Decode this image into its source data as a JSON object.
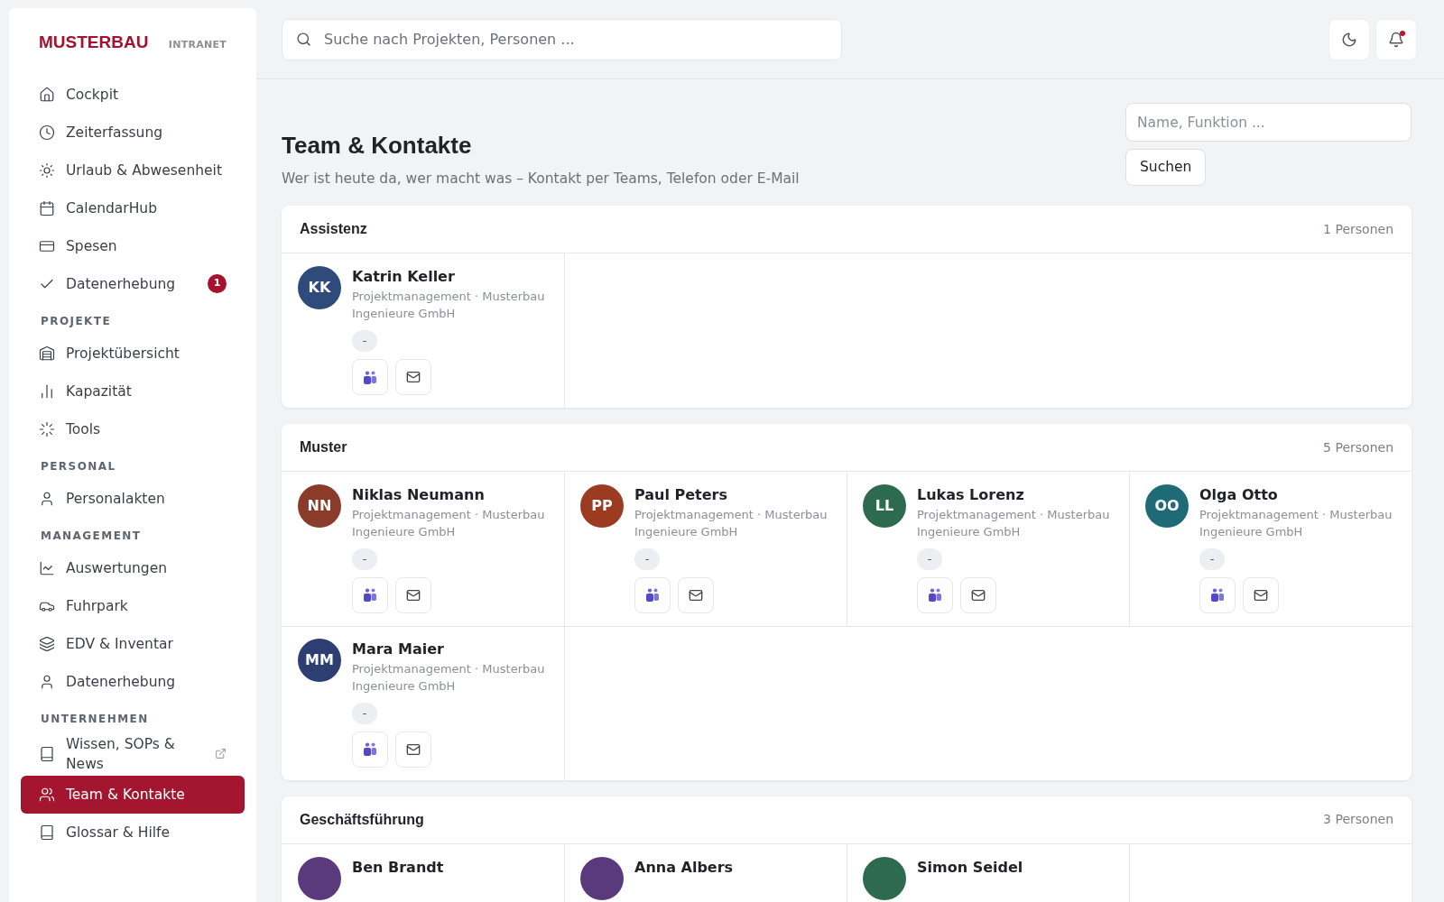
{
  "brand": {
    "name": "MUSTERBAU",
    "tag": "INTRANET"
  },
  "nav": [
    {
      "items": [
        {
          "label": "Cockpit",
          "selected": false
        },
        {
          "label": "Zeiterfassung",
          "selected": false
        },
        {
          "label": "Urlaub & Abwesenheit",
          "selected": false
        },
        {
          "label": "CalendarHub",
          "selected": false
        },
        {
          "label": "Spesen",
          "selected": false
        },
        {
          "label": "Datenerhebung",
          "selected": false,
          "badge": "1"
        }
      ]
    },
    {
      "heading": "PROJEKTE",
      "items": [
        {
          "label": "Projektübersicht",
          "selected": false
        },
        {
          "label": "Kapazität",
          "selected": false
        },
        {
          "label": "Tools",
          "selected": false
        }
      ]
    },
    {
      "heading": "PERSONAL",
      "items": [
        {
          "label": "Personalakten",
          "selected": false
        }
      ]
    },
    {
      "heading": "MANAGEMENT",
      "items": [
        {
          "label": "Auswertungen",
          "selected": false
        },
        {
          "label": "Fuhrpark",
          "selected": false
        },
        {
          "label": "EDV & Inventar",
          "selected": false
        },
        {
          "label": "Datenerhebung",
          "selected": false
        }
      ]
    },
    {
      "heading": "UNTERNEHMEN",
      "items": [
        {
          "label": "Wissen, SOPs & News",
          "selected": false,
          "external": true
        },
        {
          "label": "Team & Kontakte",
          "selected": true
        },
        {
          "label": "Glossar & Hilfe",
          "selected": false
        }
      ]
    }
  ],
  "topbar": {
    "search": {
      "placeholder": "Suche nach Projekten, Personen ..."
    },
    "notification_unread": true
  },
  "page": {
    "title": "Team & Kontakte",
    "subtitle": "Wer ist heute da, wer macht was – Kontakt per Teams, Telefon oder E-Mail",
    "filter": {
      "placeholder": "Name, Funktion ..."
    },
    "button": "Suchen"
  },
  "groups": [
    {
      "name": "Assistenz",
      "count": "1 Personen",
      "people": [
        {
          "initials": "KK",
          "color": "#2f4b7c",
          "name": "Katrin Keller",
          "role": "Projektmanagement · Musterbau Ingenieure GmbH",
          "status": "-"
        }
      ]
    },
    {
      "name": "Muster",
      "count": "5 Personen",
      "people": [
        {
          "initials": "NN",
          "color": "#8a3b2a",
          "name": "Niklas Neumann",
          "role": "Projektmanagement · Musterbau Ingenieure GmbH",
          "status": "-"
        },
        {
          "initials": "PP",
          "color": "#9b3b22",
          "name": "Paul Peters",
          "role": "Projektmanagement · Musterbau Ingenieure GmbH",
          "status": "-"
        },
        {
          "initials": "LL",
          "color": "#2e6b4e",
          "name": "Lukas Lorenz",
          "role": "Projektmanagement · Musterbau Ingenieure GmbH",
          "status": "-"
        },
        {
          "initials": "OO",
          "color": "#1e6a76",
          "name": "Olga Otto",
          "role": "Projektmanagement · Musterbau Ingenieure GmbH",
          "status": "-"
        },
        {
          "initials": "MM",
          "color": "#2c3e72",
          "name": "Mara Maier",
          "role": "Projektmanagement · Musterbau Ingenieure GmbH",
          "status": "-"
        }
      ]
    },
    {
      "name": "Geschäftsführung",
      "count": "3 Personen",
      "people": [
        {
          "color": "#5a3a7c",
          "name": "Ben Brandt"
        },
        {
          "color": "#5a3a7c",
          "name": "Anna Albers"
        },
        {
          "color": "#2e6b4e",
          "name": "Simon Seidel"
        }
      ]
    }
  ]
}
